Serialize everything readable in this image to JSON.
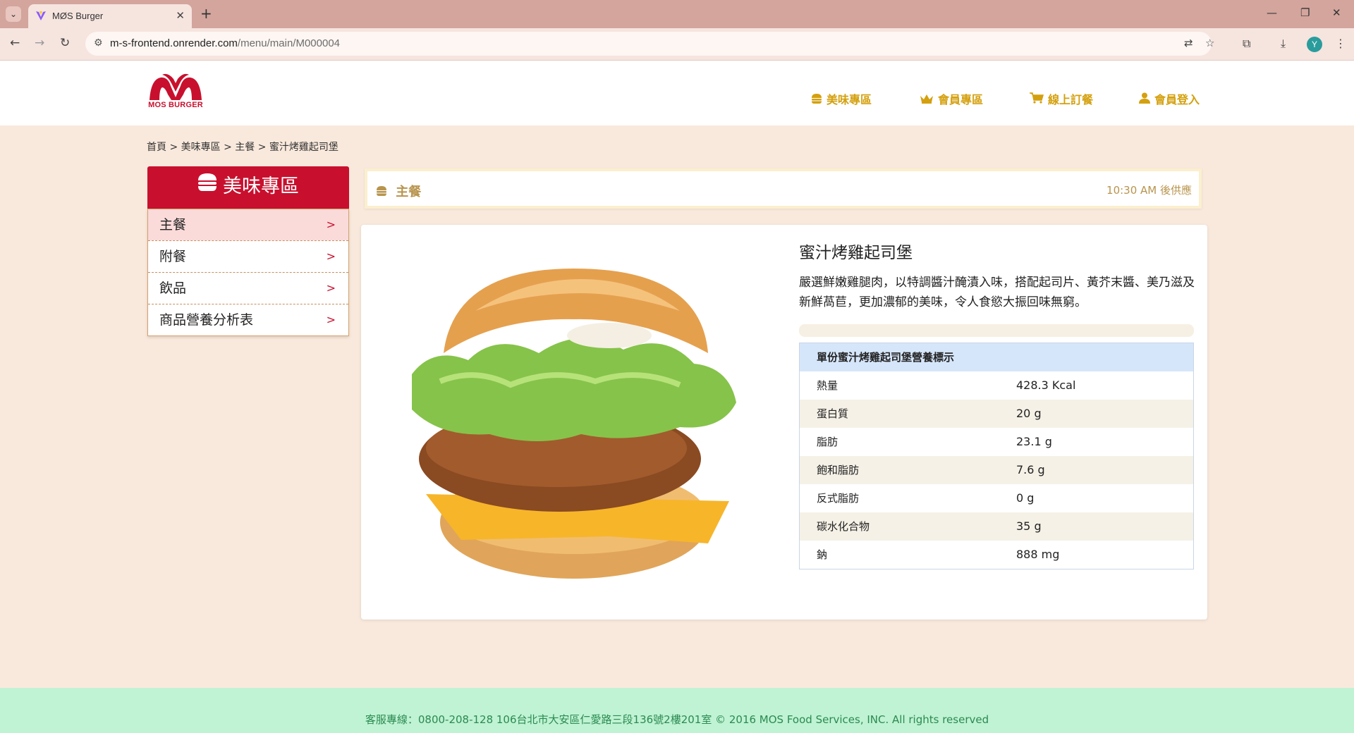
{
  "browser": {
    "tab_title": "MØS Burger",
    "url_host": "m-s-frontend.onrender.com",
    "url_path": "/menu/main/M000004",
    "profile_initial": "Y"
  },
  "header": {
    "logo_text": "MOS BURGER",
    "nav": [
      {
        "label": "美味專區",
        "icon": "burger-icon"
      },
      {
        "label": "會員專區",
        "icon": "crown-icon"
      },
      {
        "label": "線上訂餐",
        "icon": "cart-icon"
      },
      {
        "label": "會員登入",
        "icon": "user-icon"
      }
    ]
  },
  "breadcrumb": "首頁 > 美味專區 > 主餐 > 蜜汁烤雞起司堡",
  "sidebar": {
    "title": "美味專區",
    "items": [
      {
        "label": "主餐",
        "arrow": ">"
      },
      {
        "label": "附餐",
        "arrow": ">"
      },
      {
        "label": "飲品",
        "arrow": ">"
      },
      {
        "label": "商品營養分析表",
        "arrow": ">"
      }
    ]
  },
  "category": {
    "title": "主餐",
    "time_note": "10:30 AM 後供應"
  },
  "product": {
    "name": "蜜汁烤雞起司堡",
    "description": "嚴選鮮嫩雞腿肉，以特調醬汁醃漬入味，搭配起司片、黃芥末醬、美乃滋及新鮮萵苣，更加濃郁的美味，令人食慾大振回味無窮。",
    "nutrition_title": "單份蜜汁烤雞起司堡營養標示",
    "nutrition": [
      {
        "name": "熱量",
        "value": "428.3 Kcal"
      },
      {
        "name": "蛋白質",
        "value": "20 g"
      },
      {
        "name": "脂肪",
        "value": "23.1 g"
      },
      {
        "name": "飽和脂肪",
        "value": "7.6 g"
      },
      {
        "name": "反式脂肪",
        "value": "0 g"
      },
      {
        "name": "碳水化合物",
        "value": "35 g"
      },
      {
        "name": "鈉",
        "value": "888 mg"
      }
    ]
  },
  "footer": {
    "text": "客服專線：0800-208-128 106台北市大安區仁愛路三段136號2樓201室 © 2016 MOS Food Services, INC. All rights reserved"
  },
  "colors": {
    "brand_red": "#c8102e",
    "nav_gold": "#d4a00e",
    "page_bg": "#f9e9dc",
    "footer_bg": "#bff3d3"
  }
}
